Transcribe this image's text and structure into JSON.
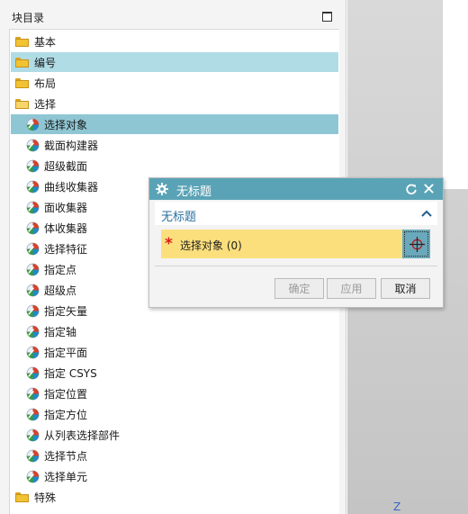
{
  "catalog": {
    "title": "块目录",
    "items": [
      {
        "label": "基本",
        "kind": "folder"
      },
      {
        "label": "编号",
        "kind": "folder",
        "state": "hover"
      },
      {
        "label": "布局",
        "kind": "folder"
      },
      {
        "label": "选择",
        "kind": "folder-open"
      },
      {
        "label": "选择对象",
        "kind": "block",
        "state": "selected"
      },
      {
        "label": "截面构建器",
        "kind": "block"
      },
      {
        "label": "超级截面",
        "kind": "block"
      },
      {
        "label": "曲线收集器",
        "kind": "block"
      },
      {
        "label": "面收集器",
        "kind": "block"
      },
      {
        "label": "体收集器",
        "kind": "block"
      },
      {
        "label": "选择特征",
        "kind": "block"
      },
      {
        "label": "指定点",
        "kind": "block"
      },
      {
        "label": "超级点",
        "kind": "block"
      },
      {
        "label": "指定矢量",
        "kind": "block"
      },
      {
        "label": "指定轴",
        "kind": "block"
      },
      {
        "label": "指定平面",
        "kind": "block"
      },
      {
        "label": "指定 CSYS",
        "kind": "block"
      },
      {
        "label": "指定位置",
        "kind": "block"
      },
      {
        "label": "指定方位",
        "kind": "block"
      },
      {
        "label": "从列表选择部件",
        "kind": "block"
      },
      {
        "label": "选择节点",
        "kind": "block"
      },
      {
        "label": "选择单元",
        "kind": "block"
      },
      {
        "label": "特殊",
        "kind": "folder"
      }
    ]
  },
  "dialog": {
    "title": "无标题",
    "group_title": "无标题",
    "select_label": "选择对象 (0)",
    "buttons": {
      "ok": "确定",
      "apply": "应用",
      "cancel": "取消"
    }
  },
  "graphics": {
    "axis_label": "Z"
  },
  "colors": {
    "titlebar": "#5aa3b6",
    "row_selected": "#8fc6d4",
    "row_hover": "#b0dce5",
    "select_row": "#fbdf7c",
    "required": "#d81b1b"
  }
}
